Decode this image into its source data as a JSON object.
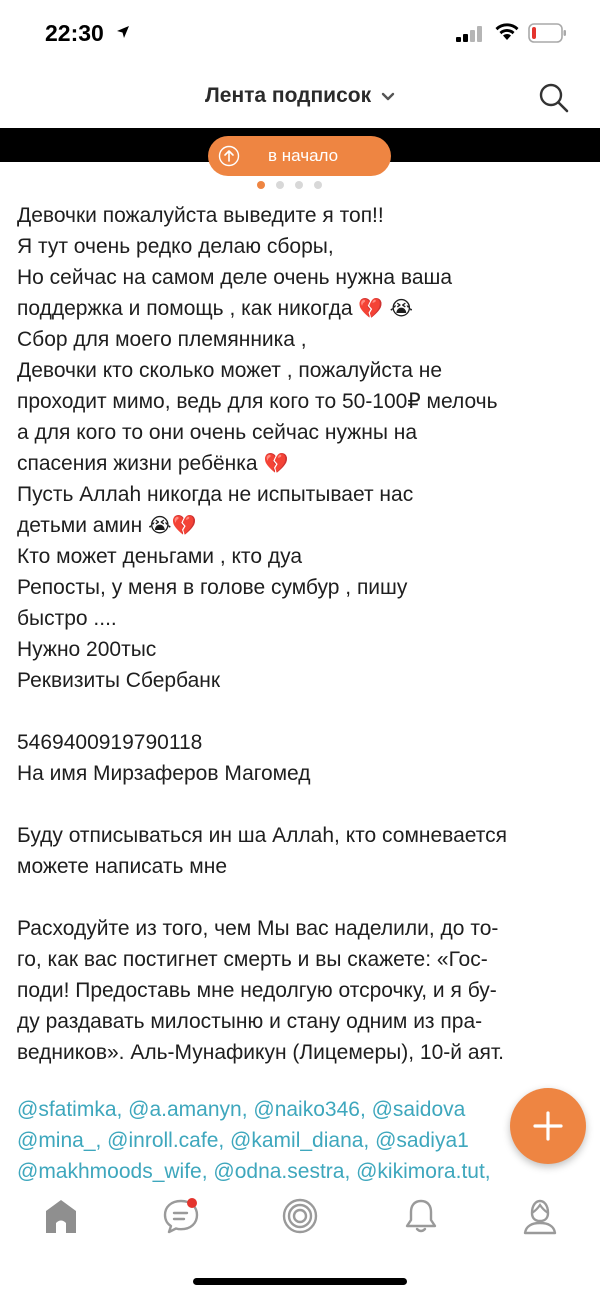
{
  "status_bar": {
    "time": "22:30",
    "icons": [
      "location-arrow-icon",
      "cellular-signal-icon",
      "wifi-icon",
      "battery-icon"
    ]
  },
  "header": {
    "title": "Лента подписок",
    "icons": [
      "chevron-down-icon",
      "search-icon"
    ]
  },
  "to_top_button": {
    "label": "в начало",
    "icon": "arrow-up-circle-icon"
  },
  "post": {
    "lines": [
      "Девочки пожалуйста выведите я топ!!",
      "Я тут очень редко делаю сборы,",
      "Но сейчас на самом деле очень нужна ваша",
      "поддержка и помощь , как никогда",
      "Сбор для моего племянника ,",
      "Девочки кто сколько может , пожалуйста не",
      "проходит мимо, ведь для кого то 50-100₽ мелочь",
      "а для кого то они очень сейчас нужны на",
      "спасения жизни ребёнка",
      "Пусть Аллаh никогда не испытывает нас",
      "детьми амин",
      "Кто может деньгами , кто дуа",
      "Репосты, у меня в голове сумбур , пишу",
      "быстро ....",
      "Нужно 200тыс",
      "Реквизиты Сбербанк",
      "",
      "5469400919790118",
      "На имя Мирзаферов Магомед",
      "",
      "Буду отписываться ин ша Аллаh, кто сомневается",
      "можете написать мне",
      "",
      "Расходуйте из того, чем Мы вас наделили, до то-",
      "го, как вас постигнет смерть и вы скажете: «Гос-",
      "поди! Предоставь мне недолгую отсрочку, и я бу-",
      "ду раздавать милостыню и стану одним из пра-",
      "ведников». Аль-Мунафикун (Лицемеры), 10-й аят."
    ],
    "emojis": {
      "line_3": "💔 😭",
      "line_8": "💔",
      "line_10": "😭💔"
    }
  },
  "mentions": {
    "lines": [
      "@sfatimka, @a.amanyn, @naiko346, @saidova",
      "@mina_, @inroll.cafe, @kamil_diana, @sadiya1",
      "@makhmoods_wife, @odna.sestra, @kikimora.tut,"
    ]
  },
  "fab": {
    "icon": "plus-icon"
  },
  "bottom_nav": {
    "items": [
      {
        "name": "home",
        "icon": "home-icon",
        "active": true
      },
      {
        "name": "messages",
        "icon": "chat-bubble-icon",
        "has_badge": true
      },
      {
        "name": "discover",
        "icon": "target-icon"
      },
      {
        "name": "notifications",
        "icon": "bell-icon"
      },
      {
        "name": "profile",
        "icon": "profile-icon"
      }
    ]
  },
  "colors": {
    "accent": "#ee8542",
    "mention": "#3ea7bd",
    "badge": "#e4342d",
    "icon_gray": "#9a9a9a"
  }
}
